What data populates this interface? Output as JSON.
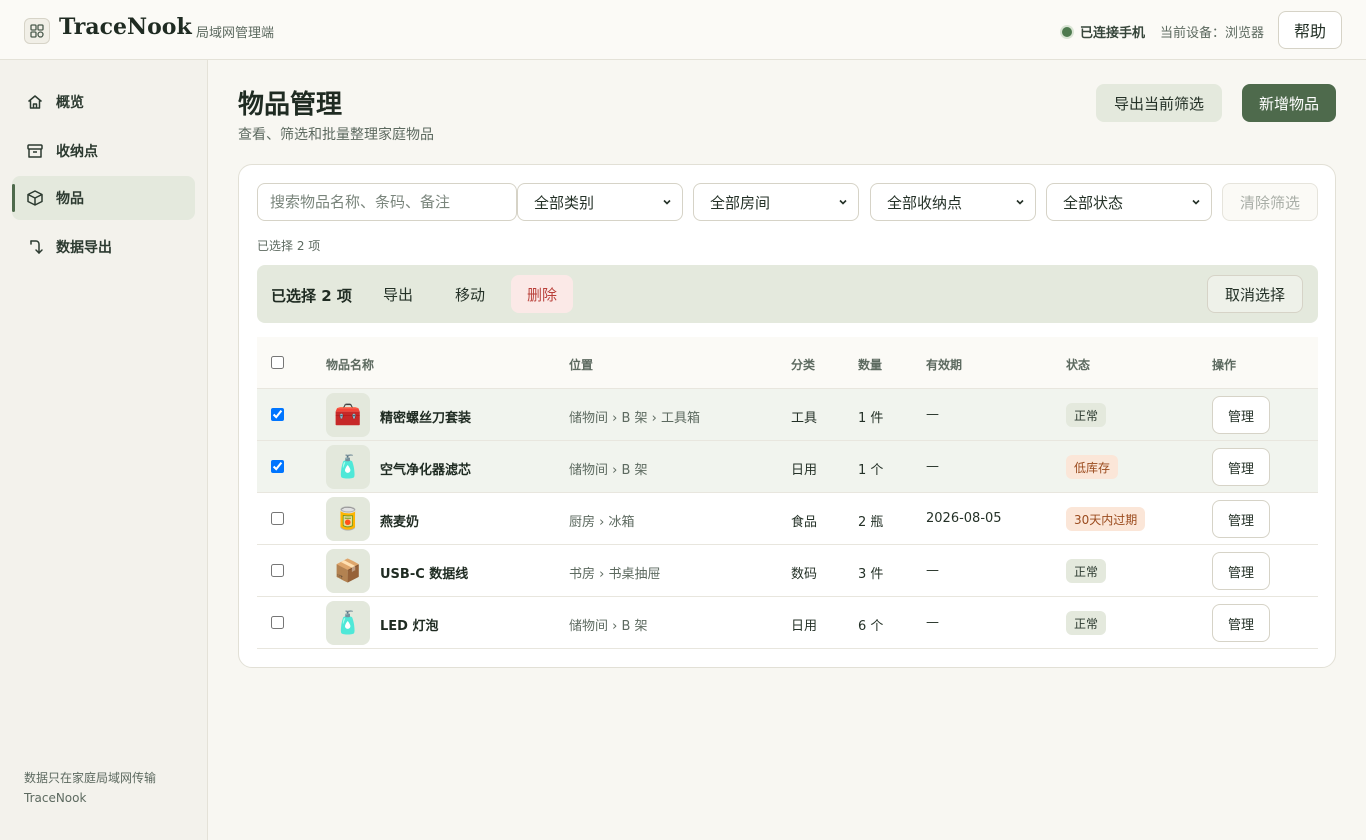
{
  "header": {
    "brand": "TraceNook",
    "subtitle": "局域网管理端",
    "connection_status": "已连接手机",
    "current_device": "当前设备：浏览器",
    "help_label": "帮助"
  },
  "sidebar": {
    "items": [
      {
        "label": "概览",
        "icon": "home-icon"
      },
      {
        "label": "收纳点",
        "icon": "archive-icon"
      },
      {
        "label": "物品",
        "icon": "box-icon",
        "active": true
      },
      {
        "label": "数据导出",
        "icon": "export-icon"
      }
    ],
    "footer_line1": "数据只在家庭局域网传输",
    "footer_line2": "TraceNook"
  },
  "page": {
    "title": "物品管理",
    "subtitle": "查看、筛选和批量整理家庭物品",
    "export_label": "导出当前筛选",
    "new_label": "新增物品"
  },
  "filters": {
    "search_placeholder": "搜索物品名称、条码、备注",
    "category": "全部类别",
    "room": "全部房间",
    "storage": "全部收纳点",
    "status": "全部状态",
    "clear_label": "清除筛选",
    "selected_count": "已选择 2 项"
  },
  "bulk": {
    "label": "已选择 2 项",
    "export": "导出",
    "move": "移动",
    "delete": "删除",
    "cancel": "取消选择"
  },
  "table": {
    "headers": {
      "name": "物品名称",
      "location": "位置",
      "category": "分类",
      "quantity": "数量",
      "expiry": "有效期",
      "status": "状态",
      "action": "操作"
    },
    "manage_label": "管理",
    "rows": [
      {
        "checked": true,
        "emoji": "🧰",
        "name": "精密螺丝刀套装",
        "location": "储物间 › B 架 › 工具箱",
        "category": "工具",
        "quantity": "1 件",
        "expiry": "—",
        "status": "正常",
        "status_type": "ok"
      },
      {
        "checked": true,
        "emoji": "🧴",
        "name": "空气净化器滤芯",
        "location": "储物间 › B 架",
        "category": "日用",
        "quantity": "1 个",
        "expiry": "—",
        "status": "低库存",
        "status_type": "warn"
      },
      {
        "checked": false,
        "emoji": "🥫",
        "name": "燕麦奶",
        "location": "厨房 › 冰箱",
        "category": "食品",
        "quantity": "2 瓶",
        "expiry": "2026-08-05",
        "status": "30天内过期",
        "status_type": "warn"
      },
      {
        "checked": false,
        "emoji": "📦",
        "name": "USB-C 数据线",
        "location": "书房 › 书桌抽屉",
        "category": "数码",
        "quantity": "3 件",
        "expiry": "—",
        "status": "正常",
        "status_type": "ok"
      },
      {
        "checked": false,
        "emoji": "🧴",
        "name": "LED 灯泡",
        "location": "储物间 › B 架",
        "category": "日用",
        "quantity": "6 个",
        "expiry": "—",
        "status": "正常",
        "status_type": "ok"
      }
    ]
  },
  "colors": {
    "accent": "#4e6a4c",
    "accent_light": "#e4e9dd",
    "danger": "#b9403a",
    "warn_bg": "#fbe6d8"
  }
}
